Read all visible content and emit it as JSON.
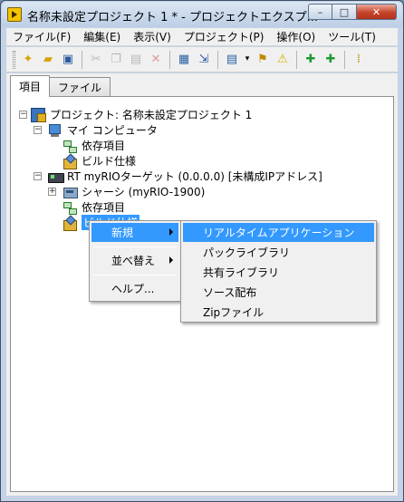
{
  "window": {
    "title": "名称未設定プロジェクト 1 * - プロジェクトエクスプ...",
    "minimize_glyph": "–",
    "maximize_glyph": "□",
    "close_glyph": "✕"
  },
  "menubar": {
    "items": [
      "ファイル(F)",
      "編集(E)",
      "表示(V)",
      "プロジェクト(P)",
      "操作(O)",
      "ツール(T)"
    ]
  },
  "toolbar": {
    "icons": [
      "new-icon",
      "open-icon",
      "save-all-icon",
      "cut-icon",
      "copy-icon",
      "paste-icon",
      "delete-icon",
      "build-icon",
      "deploy-icon",
      "view-icon",
      "dropdown-icon",
      "resolve-icon",
      "warning-icon",
      "add-icon",
      "add-folder-icon",
      "more-icon"
    ]
  },
  "tabs": [
    {
      "label": "項目",
      "active": true
    },
    {
      "label": "ファイル",
      "active": false
    }
  ],
  "tree": {
    "project": "プロジェクト: 名称未設定プロジェクト 1",
    "my_computer": "マイ コンピュータ",
    "my_computer_deps": "依存項目",
    "my_computer_build": "ビルド仕様",
    "rt_target": "RT myRIOターゲット (0.0.0.0) [未構成IPアドレス]",
    "chassis": "シャーシ (myRIO-1900)",
    "rt_deps": "依存項目",
    "rt_build": "ビルド仕様"
  },
  "context_menu": {
    "items": [
      {
        "label": "新規",
        "has_submenu": true,
        "hover": true
      },
      {
        "label": "並べ替え",
        "has_submenu": true,
        "hover": false
      },
      {
        "label": "ヘルプ...",
        "has_submenu": false,
        "hover": false
      }
    ]
  },
  "submenu": {
    "items": [
      {
        "label": "リアルタイムアプリケーション",
        "hover": true
      },
      {
        "label": "パックライブラリ",
        "hover": false
      },
      {
        "label": "共有ライブラリ",
        "hover": false
      },
      {
        "label": "ソース配布",
        "hover": false
      },
      {
        "label": "Zipファイル",
        "hover": false
      }
    ]
  },
  "colors": {
    "selection": "#3399ff",
    "frame": "#c4d3e6"
  }
}
